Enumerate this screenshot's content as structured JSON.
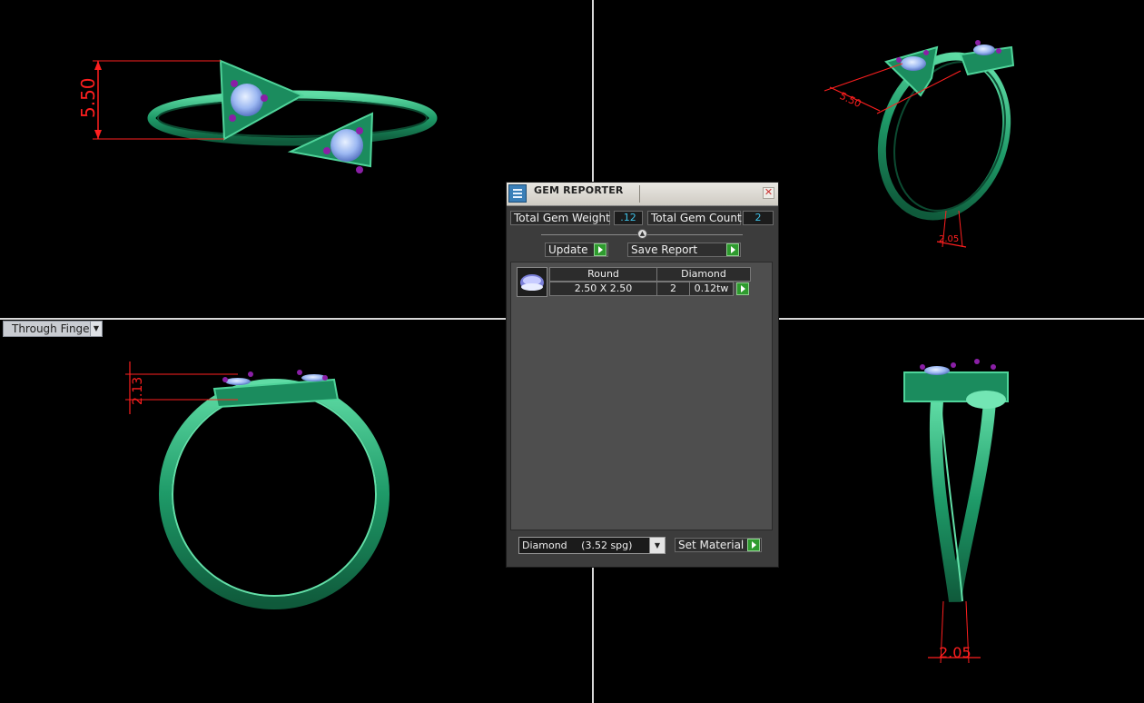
{
  "viewports": {
    "top_left": {
      "dimension": "5.50"
    },
    "top_right": {
      "dimension_top": "5.50",
      "dimension_bottom": "2.05"
    },
    "bottom_left": {
      "view_name": "Through Finger",
      "dimension": "2.13"
    },
    "bottom_right": {
      "dimension": "2.05"
    }
  },
  "dialog": {
    "title": "GEM REPORTER",
    "total_weight_label": "Total Gem Weight",
    "total_weight_value": ".12",
    "total_count_label": "Total Gem Count",
    "total_count_value": "2",
    "update_label": "Update",
    "save_report_label": "Save Report",
    "gems": [
      {
        "shape": "Round",
        "material": "Diamond",
        "size": "2.50 X 2.50",
        "count": "2",
        "weight": "0.12tw"
      }
    ],
    "material_select": {
      "name": "Diamond",
      "spg": "(3.52 spg)"
    },
    "set_material_label": "Set Material"
  },
  "colors": {
    "ring": "#21a06e",
    "ring_highlight": "#62e0a8",
    "gem": "#9cb8f2",
    "prong": "#8a1fa6",
    "dimension": "#ff1f1f",
    "value_text": "#3fc0e6",
    "go_button": "#2e9b2e"
  },
  "icons": [
    "gem-reporter-icon",
    "close-icon",
    "collapse-icon",
    "play-icon",
    "dropdown-arrow-icon",
    "gem-thumbnail-icon"
  ]
}
